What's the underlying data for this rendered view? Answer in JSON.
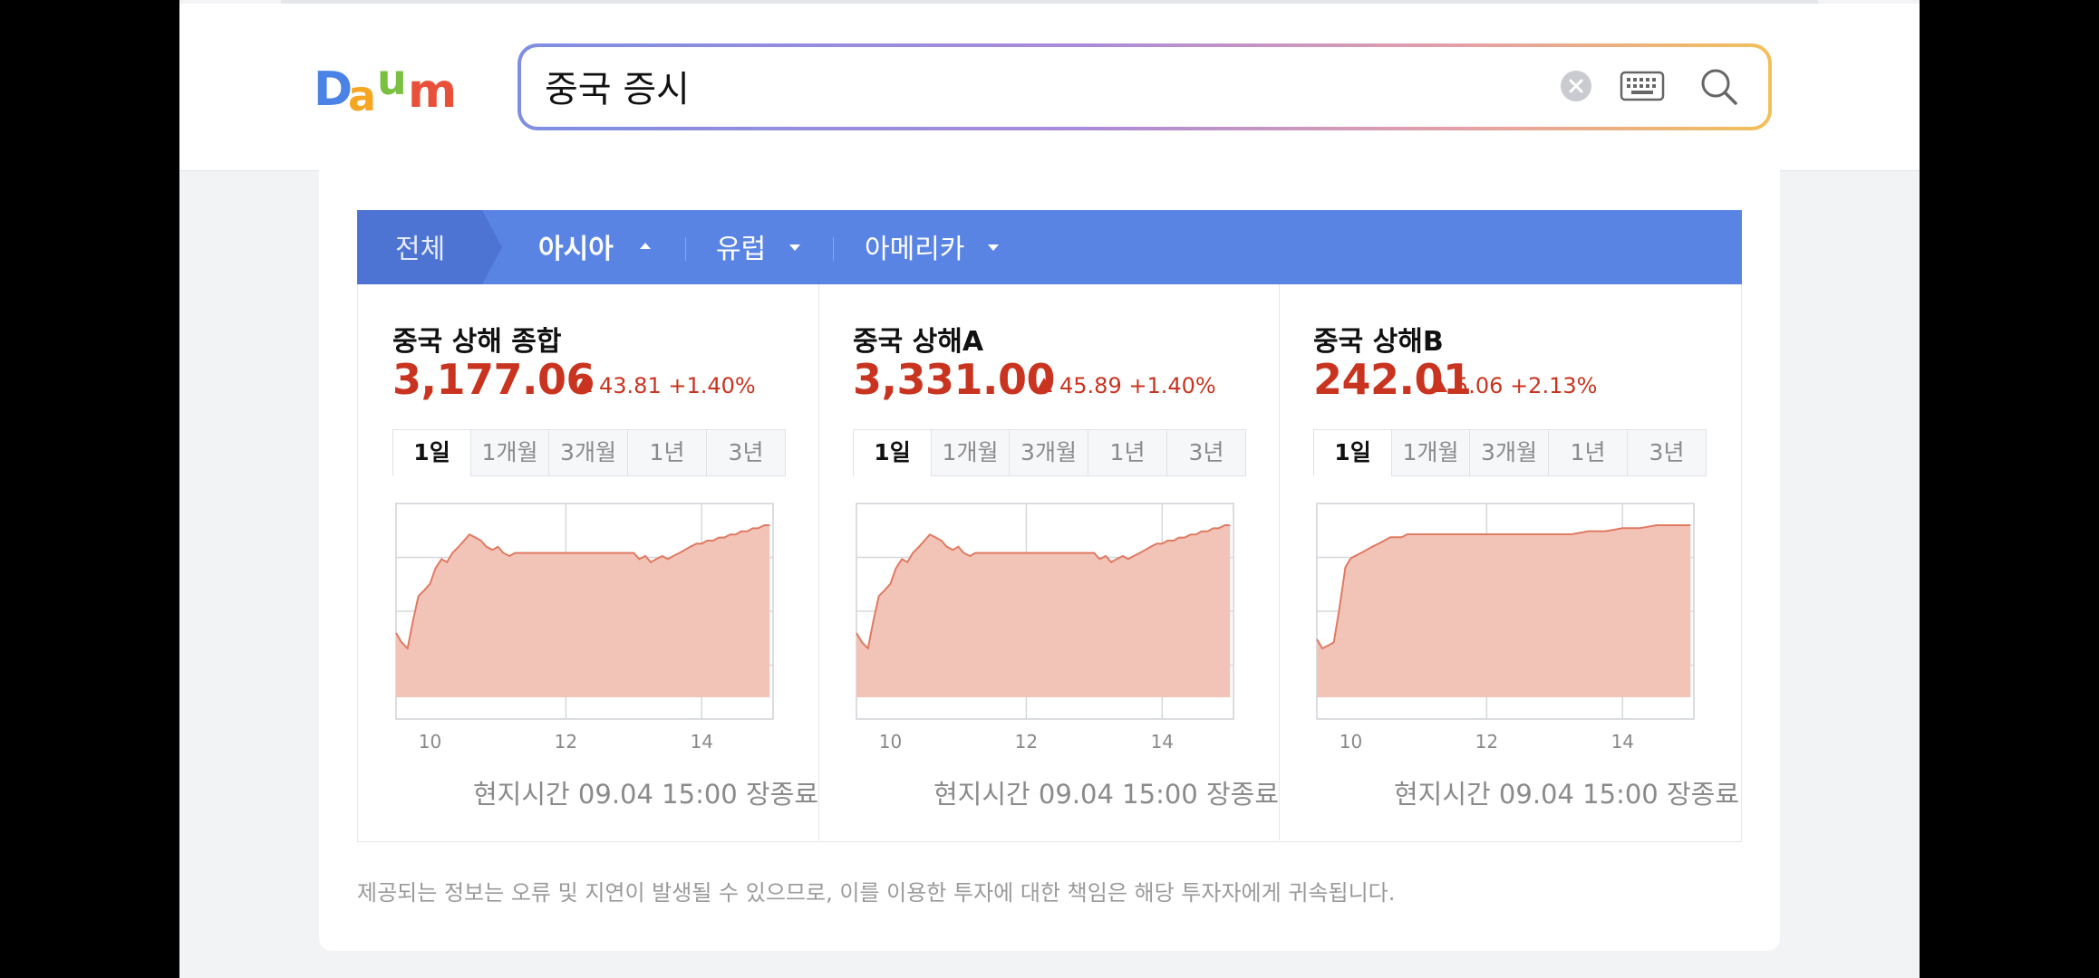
{
  "search": {
    "query": "중국 증시"
  },
  "tabs": [
    {
      "label": "전체"
    },
    {
      "label": "아시아"
    },
    {
      "label": "유럽"
    },
    {
      "label": "아메리카"
    }
  ],
  "range_tabs": [
    "1일",
    "1개월",
    "3개월",
    "1년",
    "3년"
  ],
  "panels": [
    {
      "name": "중국 상해 종합",
      "value": "3,177.06",
      "change": "43.81 +1.40%",
      "time": "현지시간 09.04 15:00 장종료"
    },
    {
      "name": "중국 상해A",
      "value": "3,331.00",
      "change": "45.89 +1.40%",
      "time": "현지시간 09.04 15:00 장종료"
    },
    {
      "name": "중국 상해B",
      "value": "242.01",
      "change": "5.06 +2.13%",
      "time": "현지시간 09.04 15:00 장종료"
    }
  ],
  "disclaimer": "제공되는 정보는 오류 및 지연이 발생될 수 있으므로, 이를 이용한 투자에 대한 책임은 해당 투자자에게 귀속됩니다.",
  "colors": {
    "accent": "#5a84e4",
    "up": "#c8341f",
    "area": "#f2c4b8",
    "line": "#e07a62"
  },
  "icons": [
    "daum-logo",
    "clear-icon",
    "keyboard-icon",
    "search-icon",
    "caret-up-icon",
    "caret-down-icon",
    "triangle-up-icon"
  ],
  "chart_data": [
    {
      "type": "area",
      "x_ticks": [
        "10",
        "12",
        "14"
      ],
      "x": [
        9.5,
        9.58,
        9.67,
        9.75,
        9.83,
        9.92,
        10.0,
        10.08,
        10.17,
        10.25,
        10.33,
        10.42,
        10.5,
        10.58,
        10.67,
        10.75,
        10.83,
        10.92,
        11.0,
        11.08,
        11.17,
        11.25,
        11.33,
        11.5,
        11.75,
        12.0,
        12.25,
        12.5,
        12.75,
        13.0,
        13.08,
        13.17,
        13.25,
        13.33,
        13.42,
        13.5,
        13.58,
        13.67,
        13.75,
        13.83,
        13.92,
        14.0,
        14.08,
        14.17,
        14.25,
        14.33,
        14.42,
        14.5,
        14.58,
        14.67,
        14.75,
        14.83,
        14.92,
        15.0
      ],
      "values": [
        3142,
        3139,
        3137,
        3146,
        3154,
        3156,
        3158,
        3163,
        3166,
        3165,
        3168,
        3170,
        3172,
        3174,
        3173,
        3172,
        3170,
        3169,
        3170,
        3168,
        3167,
        3168,
        3168,
        3168,
        3168,
        3168,
        3168,
        3168,
        3168,
        3168,
        3166,
        3167,
        3165,
        3166,
        3167,
        3166,
        3167,
        3168,
        3169,
        3170,
        3171,
        3171,
        3172,
        3172,
        3173,
        3173,
        3174,
        3174,
        3175,
        3175,
        3176,
        3176,
        3177,
        3177
      ]
    },
    {
      "type": "area",
      "x_ticks": [
        "10",
        "12",
        "14"
      ],
      "x": [
        9.5,
        9.58,
        9.67,
        9.75,
        9.83,
        9.92,
        10.0,
        10.08,
        10.17,
        10.25,
        10.33,
        10.42,
        10.5,
        10.58,
        10.67,
        10.75,
        10.83,
        10.92,
        11.0,
        11.08,
        11.17,
        11.25,
        11.33,
        11.5,
        11.75,
        12.0,
        12.25,
        12.5,
        12.75,
        13.0,
        13.08,
        13.17,
        13.25,
        13.33,
        13.42,
        13.5,
        13.58,
        13.67,
        13.75,
        13.83,
        13.92,
        14.0,
        14.08,
        14.17,
        14.25,
        14.33,
        14.42,
        14.5,
        14.58,
        14.67,
        14.75,
        14.83,
        14.92,
        15.0
      ],
      "values": [
        3296,
        3293,
        3291,
        3300,
        3308,
        3310,
        3312,
        3317,
        3320,
        3319,
        3322,
        3324,
        3326,
        3328,
        3327,
        3326,
        3324,
        3323,
        3324,
        3322,
        3321,
        3322,
        3322,
        3322,
        3322,
        3322,
        3322,
        3322,
        3322,
        3322,
        3320,
        3321,
        3319,
        3320,
        3321,
        3320,
        3321,
        3322,
        3323,
        3324,
        3325,
        3325,
        3326,
        3326,
        3327,
        3327,
        3328,
        3328,
        3329,
        3329,
        3330,
        3330,
        3331,
        3331
      ]
    },
    {
      "type": "area",
      "x_ticks": [
        "10",
        "12",
        "14"
      ],
      "x": [
        9.5,
        9.58,
        9.67,
        9.75,
        9.83,
        9.92,
        10.0,
        10.08,
        10.17,
        10.25,
        10.33,
        10.42,
        10.5,
        10.58,
        10.67,
        10.75,
        10.83,
        10.92,
        11.0,
        11.5,
        12.0,
        12.5,
        13.0,
        13.25,
        13.5,
        13.75,
        14.0,
        14.25,
        14.5,
        14.75,
        15.0
      ],
      "values": [
        238.2,
        237.9,
        238.0,
        238.1,
        239.2,
        240.6,
        240.9,
        241.0,
        241.1,
        241.2,
        241.3,
        241.4,
        241.5,
        241.6,
        241.6,
        241.6,
        241.7,
        241.7,
        241.7,
        241.7,
        241.7,
        241.7,
        241.7,
        241.7,
        241.8,
        241.8,
        241.9,
        241.9,
        242.0,
        242.0,
        242.0
      ]
    }
  ]
}
